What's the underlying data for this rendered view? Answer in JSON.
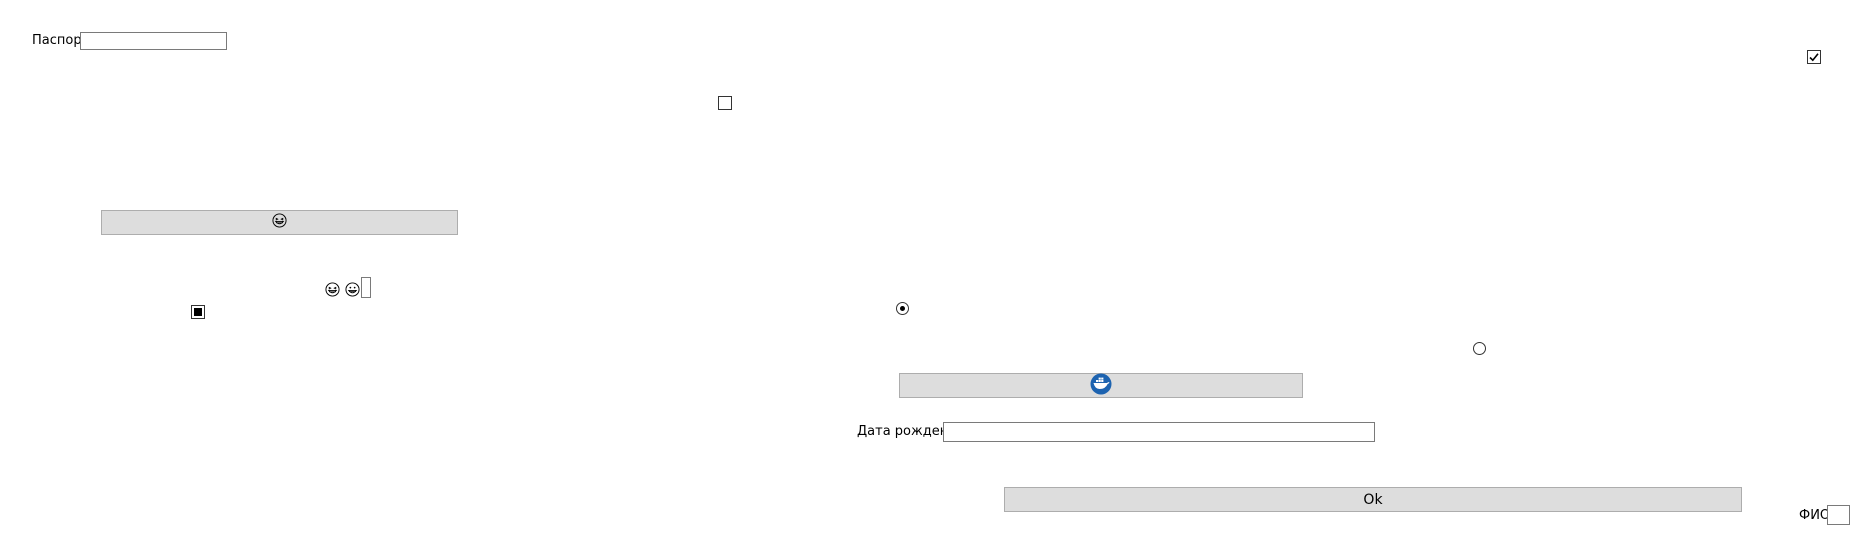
{
  "form": {
    "passport": {
      "label": "Паспорт",
      "value": ""
    },
    "birth_date": {
      "label": "Дата рождения",
      "value": ""
    },
    "fio": {
      "label": "ФИО",
      "value": ""
    },
    "small_field": {
      "value": ""
    },
    "ok_button": {
      "label": "Ok"
    },
    "checkboxes": {
      "top_right": {
        "checked": true
      },
      "middle": {
        "checked": false
      },
      "left": {
        "state": "indeterminate"
      }
    },
    "radios": {
      "first": {
        "selected": true
      },
      "second": {
        "selected": false
      }
    },
    "emoji_button": {
      "icon": "grinning-squint-face-icon"
    },
    "emoji_row": {
      "icons": [
        "grinning-squint-face-icon",
        "grinning-face-icon"
      ]
    },
    "image_button": {
      "icon": "docker-whale-logo-icon"
    }
  },
  "colors": {
    "button_bg": "#dddddd",
    "button_border": "#adadad",
    "textbox_border": "#7a7a7a",
    "logo_blue": "#1d63b0"
  }
}
